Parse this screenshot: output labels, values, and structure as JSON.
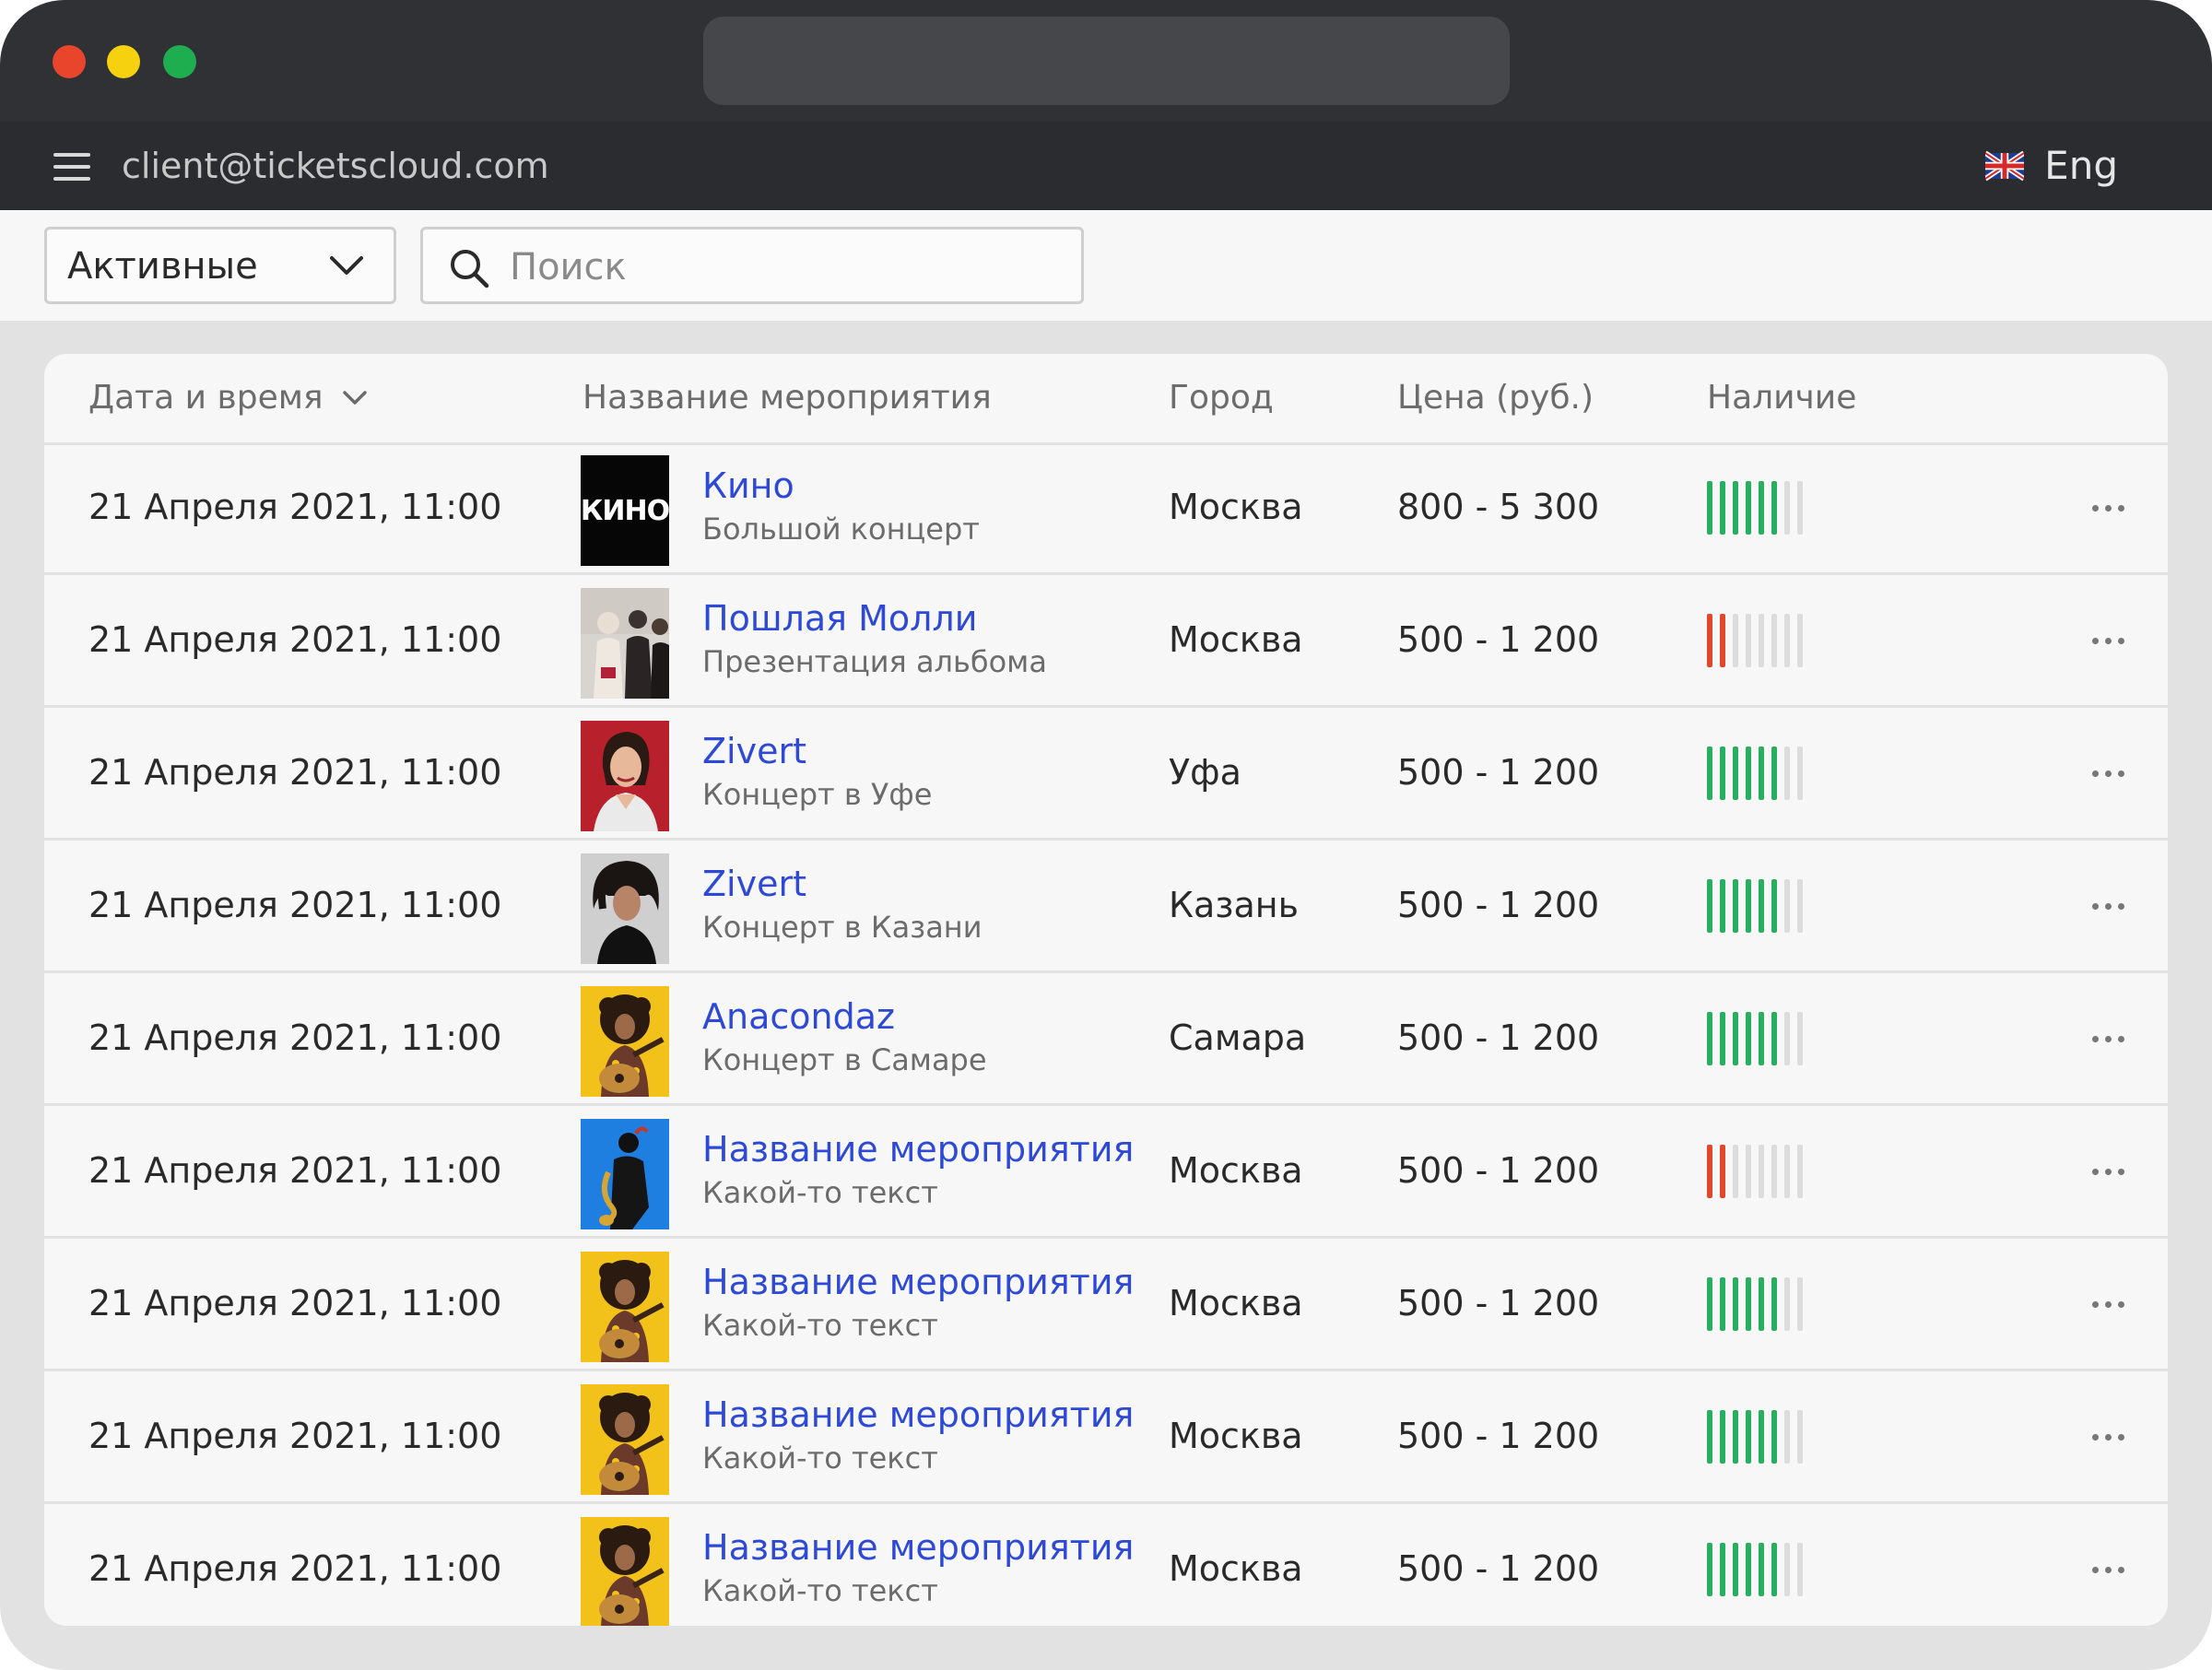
{
  "header": {
    "user_email": "client@ticketscloud.com",
    "language": "Eng",
    "menu_icon": "hamburger-menu-icon",
    "flag_icon": "uk-flag-icon"
  },
  "filters": {
    "status_value": "Активные",
    "search_placeholder": "Поиск",
    "search_value": ""
  },
  "table": {
    "columns": {
      "date": "Дата и время",
      "name": "Название мероприятия",
      "city": "Город",
      "price": "Цена (руб.)",
      "availability": "Наличие"
    },
    "availability_total": 8,
    "colors": {
      "high": "#27ae60",
      "low": "#e2472c",
      "empty": "#dcdcdc"
    },
    "rows": [
      {
        "date": "21 Апреля 2021, 11:00",
        "title": "Кино",
        "subtitle": "Большой концерт",
        "city": "Москва",
        "price": "800 - 5 300",
        "availability": 6,
        "status": "high",
        "thumb": "kino-logo",
        "thumb_text": "КИНО"
      },
      {
        "date": "21 Апреля 2021, 11:00",
        "title": "Пошлая Молли",
        "subtitle": "Презентация альбома",
        "city": "Москва",
        "price": "500 - 1 200",
        "availability": 2,
        "status": "low",
        "thumb": "band-photo"
      },
      {
        "date": "21 Апреля 2021, 11:00",
        "title": "Zivert",
        "subtitle": "Концерт в Уфе",
        "city": "Уфа",
        "price": "500 - 1 200",
        "availability": 6,
        "status": "high",
        "thumb": "portrait-red"
      },
      {
        "date": "21 Апреля 2021, 11:00",
        "title": "Zivert",
        "subtitle": "Концерт в Казани",
        "city": "Казань",
        "price": "500 - 1 200",
        "availability": 6,
        "status": "high",
        "thumb": "portrait-grey"
      },
      {
        "date": "21 Апреля 2021, 11:00",
        "title": "Anacondaz",
        "subtitle": "Концерт в Самаре",
        "city": "Самара",
        "price": "500 - 1 200",
        "availability": 6,
        "status": "high",
        "thumb": "guitarist-yellow"
      },
      {
        "date": "21 Апреля 2021, 11:00",
        "title": "Название мероприятия",
        "subtitle": "Какой-то текст",
        "city": "Москва",
        "price": "500 - 1 200",
        "availability": 2,
        "status": "low",
        "thumb": "saxophone-blue"
      },
      {
        "date": "21 Апреля 2021, 11:00",
        "title": "Название мероприятия",
        "subtitle": "Какой-то текст",
        "city": "Москва",
        "price": "500 - 1 200",
        "availability": 6,
        "status": "high",
        "thumb": "guitarist-yellow"
      },
      {
        "date": "21 Апреля 2021, 11:00",
        "title": "Название мероприятия",
        "subtitle": "Какой-то текст",
        "city": "Москва",
        "price": "500 - 1 200",
        "availability": 6,
        "status": "high",
        "thumb": "guitarist-yellow"
      },
      {
        "date": "21 Апреля 2021, 11:00",
        "title": "Название мероприятия",
        "subtitle": "Какой-то текст",
        "city": "Москва",
        "price": "500 - 1 200",
        "availability": 6,
        "status": "high",
        "thumb": "guitarist-yellow"
      }
    ]
  }
}
